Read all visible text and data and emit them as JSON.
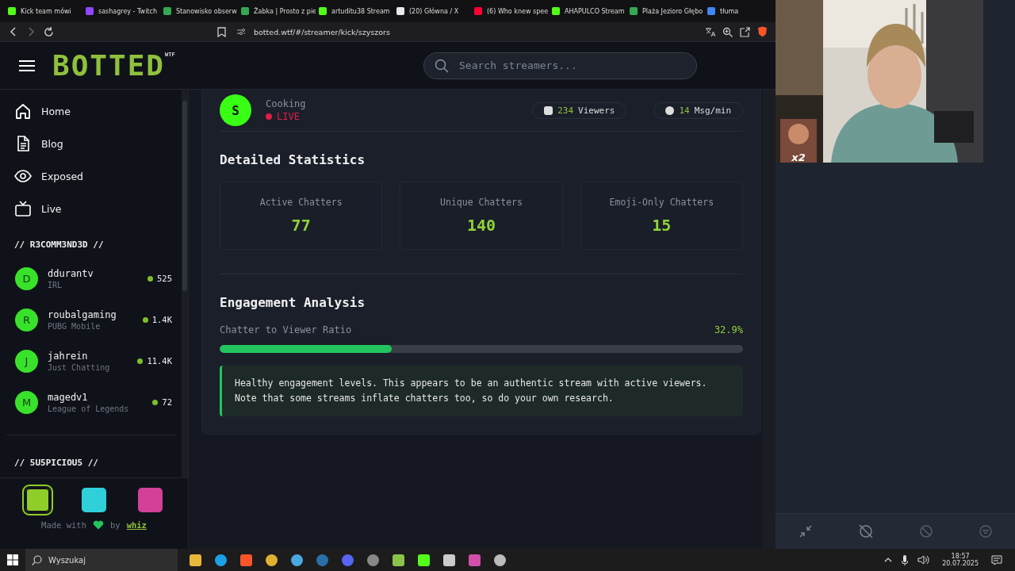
{
  "browser": {
    "tabs": [
      {
        "title": "Kick team mówi",
        "color": "#53fc18",
        "selected": false
      },
      {
        "title": "sashagrey - Twitch",
        "color": "#9146ff",
        "selected": false
      },
      {
        "title": "Stanowisko obserw",
        "color": "#34a853",
        "selected": false
      },
      {
        "title": "Żabka | Prosto z pie",
        "color": "#34a853",
        "selected": false
      },
      {
        "title": "artuditu38 Stream",
        "color": "#53fc18",
        "selected": false
      },
      {
        "title": "(20) Główna / X",
        "color": "#e7e9ea",
        "selected": false
      },
      {
        "title": "(6) Who knew spee",
        "color": "#ff0033",
        "selected": false
      },
      {
        "title": "AHAPULCO Stream",
        "color": "#53fc18",
        "selected": false
      },
      {
        "title": "Plaża Jezioro Głębo",
        "color": "#34a853",
        "selected": false
      },
      {
        "title": "tłuma",
        "color": "#4285f4",
        "selected": false
      }
    ],
    "url": "botted.wtf/#/streamer/kick/szyszors"
  },
  "header": {
    "logo": "BOTTED",
    "logo_sup": "WTF",
    "search_placeholder": "Search streamers..."
  },
  "nav": [
    {
      "label": "Home"
    },
    {
      "label": "Blog"
    },
    {
      "label": "Exposed"
    },
    {
      "label": "Live"
    }
  ],
  "sidebar": {
    "recommended_heading": "// R3COMM3ND3D //",
    "streamers": [
      {
        "initial": "D",
        "name": "ddurantv",
        "category": "IRL",
        "viewers": "525"
      },
      {
        "initial": "R",
        "name": "roubalgaming",
        "category": "PUBG Mobile",
        "viewers": "1.4K"
      },
      {
        "initial": "J",
        "name": "jahrein",
        "category": "Just Chatting",
        "viewers": "11.4K"
      },
      {
        "initial": "M",
        "name": "magedv1",
        "category": "League of Legends",
        "viewers": "72"
      }
    ],
    "suspicious_heading": "// 5U5PICIOU5 //",
    "themes": [
      {
        "color": "#8fce28",
        "selected": true
      },
      {
        "color": "#2fd0da",
        "selected": false
      },
      {
        "color": "#d43f97",
        "selected": false
      }
    ],
    "footer": {
      "made_with": "Made with",
      "by": "by",
      "link": "whiz"
    }
  },
  "streamer": {
    "avatar": "S",
    "category": "Cooking",
    "status": "LIVE",
    "stats": [
      {
        "value": "234",
        "label": "Viewers"
      },
      {
        "value": "14",
        "label": "Msg/min"
      }
    ]
  },
  "detailed": {
    "title": "Detailed Statistics",
    "cards": [
      {
        "label": "Active Chatters",
        "value": "77"
      },
      {
        "label": "Unique Chatters",
        "value": "140"
      },
      {
        "label": "Emoji-Only Chatters",
        "value": "15"
      }
    ]
  },
  "engagement": {
    "title": "Engagement Analysis",
    "ratio_label": "Chatter to Viewer Ratio",
    "ratio_value": "32.9%",
    "level": 0.329,
    "message": "Healthy engagement levels. This appears to be an authentic stream with active viewers. Note that some streams inflate chatters too, so do your own research."
  },
  "overlay": {
    "badge": "x2"
  },
  "taskbar": {
    "search_placeholder": "Wyszukaj",
    "time": "18:57",
    "date": "20.07.2025"
  }
}
